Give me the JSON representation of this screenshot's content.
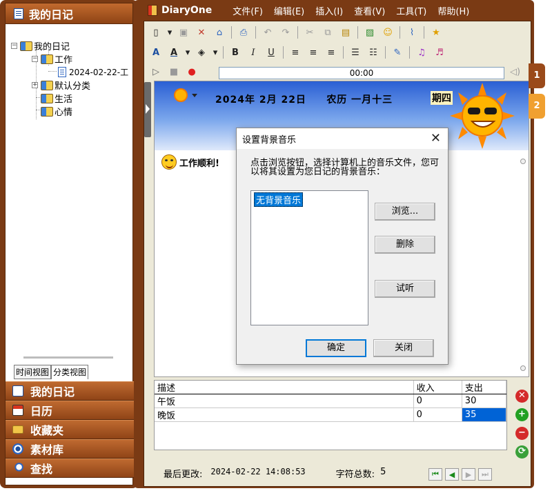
{
  "sidebar": {
    "header": "我的日记",
    "tree": {
      "root": "我的日记",
      "work": "工作",
      "entry": "2024-02-22-工",
      "default_category": "默认分类",
      "life": "生活",
      "mood": "心情"
    },
    "view_tabs": [
      "时间视图",
      "分类视图"
    ],
    "nav": [
      {
        "label": "我的日记",
        "icon": "diary-icon"
      },
      {
        "label": "日历",
        "icon": "calendar-icon"
      },
      {
        "label": "收藏夹",
        "icon": "folder-icon"
      },
      {
        "label": "素材库",
        "icon": "camera-icon"
      },
      {
        "label": "查找",
        "icon": "search-icon"
      }
    ]
  },
  "app": {
    "title": "DiaryOne",
    "menu": [
      "文件(F)",
      "编辑(E)",
      "插入(I)",
      "查看(V)",
      "工具(T)",
      "帮助(H)"
    ]
  },
  "player": {
    "time": "00:00"
  },
  "diary": {
    "date": "2024年  2月 22日",
    "lunar": "农历  一月十三",
    "weekday": "期四",
    "note": "工作顺利!"
  },
  "page_tabs": [
    "1",
    "2"
  ],
  "expenses": {
    "headers": [
      "描述",
      "收入",
      "支出"
    ],
    "rows": [
      {
        "desc": "午饭",
        "income": "0",
        "expense": "30"
      },
      {
        "desc": "晚饭",
        "income": "0",
        "expense": "35"
      }
    ]
  },
  "status": {
    "last_modified_label": "最后更改:",
    "last_modified": "2024-02-22 14:08:53",
    "char_count_label": "字符总数:",
    "char_count": "5"
  },
  "dialog": {
    "title": "设置背景音乐",
    "message": "点击浏览按钮，选择计算机上的音乐文件，您可以将其设置为您日记的背景音乐：",
    "list_item": "无背景音乐",
    "browse": "浏览...",
    "delete": "删除",
    "preview": "试听",
    "ok": "确定",
    "close": "关闭"
  },
  "colors": {
    "frame": "#7a3a14",
    "nav_gradient_top": "#bf6a30",
    "selection": "#0078d7"
  }
}
